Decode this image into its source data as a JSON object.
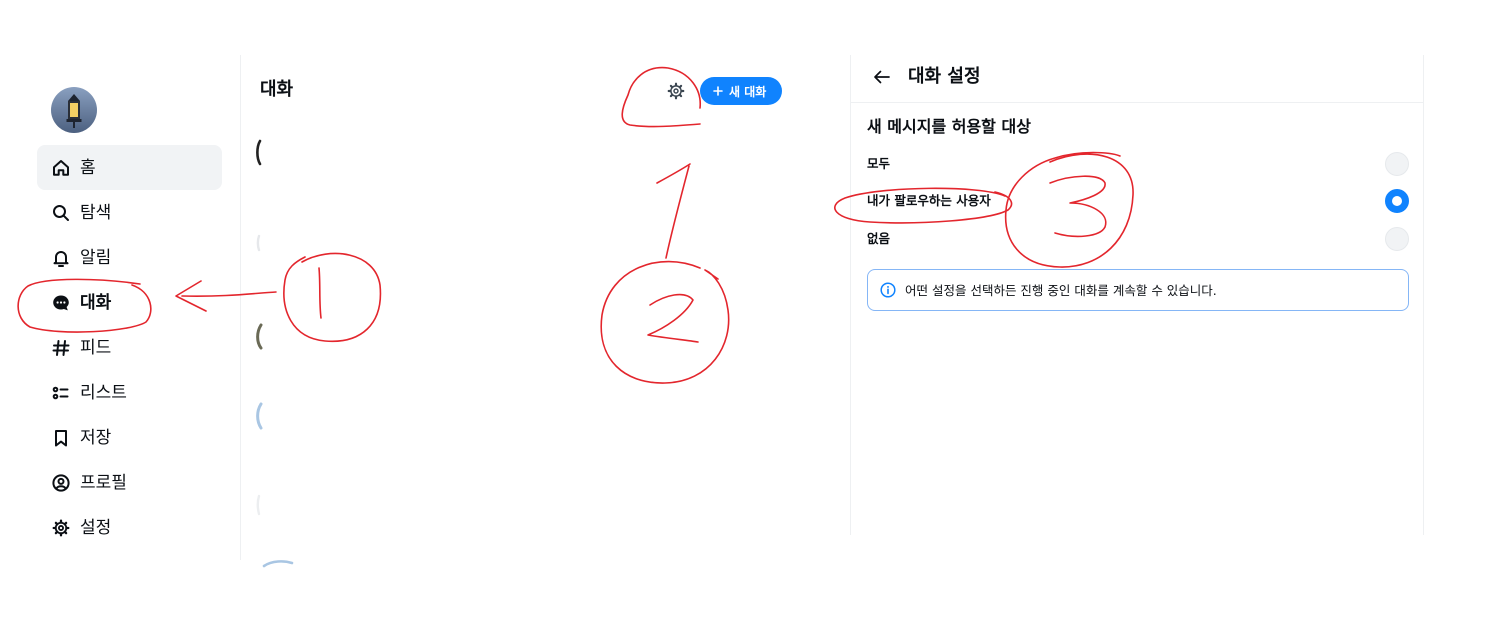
{
  "sidebar": {
    "items": [
      {
        "label": "홈",
        "icon": "home-icon",
        "highlighted": true,
        "active": false
      },
      {
        "label": "탐색",
        "icon": "search-icon",
        "highlighted": false,
        "active": false
      },
      {
        "label": "알림",
        "icon": "bell-icon",
        "highlighted": false,
        "active": false
      },
      {
        "label": "대화",
        "icon": "chat-icon",
        "highlighted": false,
        "active": true
      },
      {
        "label": "피드",
        "icon": "hashtag-icon",
        "highlighted": false,
        "active": false
      },
      {
        "label": "리스트",
        "icon": "list-icon",
        "highlighted": false,
        "active": false
      },
      {
        "label": "저장",
        "icon": "bookmark-icon",
        "highlighted": false,
        "active": false
      },
      {
        "label": "프로필",
        "icon": "profile-icon",
        "highlighted": false,
        "active": false
      },
      {
        "label": "설정",
        "icon": "settings-icon",
        "highlighted": false,
        "active": false
      }
    ]
  },
  "conversations": {
    "title": "대화",
    "settings_icon": "gear-icon",
    "new_chat_label": "새 대화",
    "new_chat_icon": "plus-icon"
  },
  "chat_settings": {
    "back_icon": "arrow-left-icon",
    "title": "대화 설정",
    "section_title": "새 메시지를 허용할 대상",
    "options": [
      {
        "label": "모두",
        "selected": false
      },
      {
        "label": "내가 팔로우하는 사용자",
        "selected": true
      },
      {
        "label": "없음",
        "selected": false
      }
    ],
    "info_icon": "info-icon",
    "info_text": "어떤 설정을 선택하든 진행 중인 대화를 계속할 수 있습니다."
  },
  "annotations": [
    {
      "step": 1
    },
    {
      "step": 2
    },
    {
      "step": 3
    }
  ],
  "colors": {
    "accent": "#1083fe",
    "text": "#0b0f14",
    "annotation": "#e3262d"
  }
}
